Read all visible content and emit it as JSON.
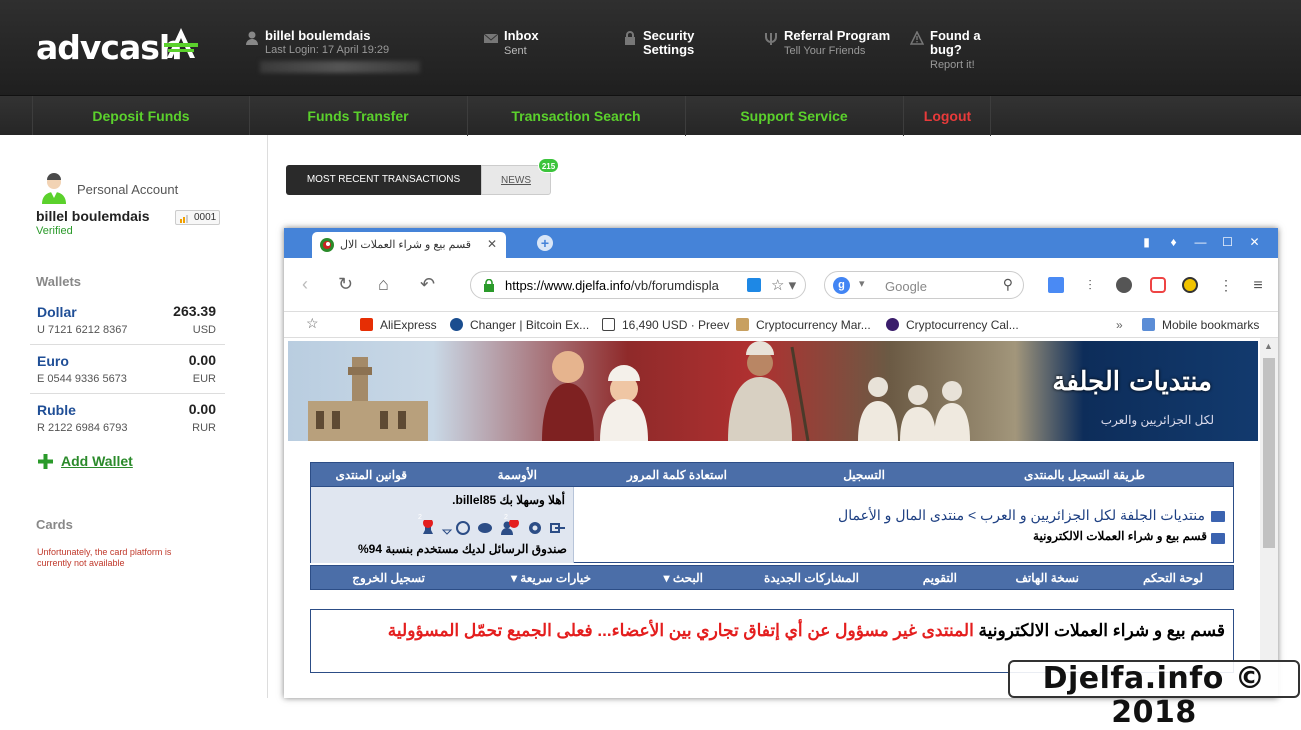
{
  "app": {
    "brand_prefix": "adv",
    "brand_suffix": "cash",
    "brand_color": "#5bd12c"
  },
  "topbar": {
    "user_name": "billel boulemdais",
    "last_login": "Last Login: 17 April 19:29",
    "inbox": {
      "label": "Inbox",
      "sub": "Sent"
    },
    "security": {
      "line1": "Security",
      "line2": "Settings"
    },
    "referral": {
      "label": "Referral Program",
      "sub": "Tell Your Friends"
    },
    "bug": {
      "line1": "Found a",
      "line2": "bug?",
      "sub": "Report it!"
    }
  },
  "nav": {
    "deposit": "Deposit Funds",
    "transfer": "Funds Transfer",
    "search": "Transaction Search",
    "support": "Support Service",
    "logout": "Logout"
  },
  "account": {
    "type": "Personal Account",
    "name": "billel boulemdais",
    "status": "Verified",
    "badge": "0001"
  },
  "wallets": {
    "title": "Wallets",
    "items": [
      {
        "name": "Dollar",
        "number": "U 7121 6212 8367",
        "amount": "263.39",
        "currency": "USD"
      },
      {
        "name": "Euro",
        "number": "E 0544 9336 5673",
        "amount": "0.00",
        "currency": "EUR"
      },
      {
        "name": "Ruble",
        "number": "R 2122 6984 6793",
        "amount": "0.00",
        "currency": "RUR"
      }
    ],
    "add_label": "Add Wallet"
  },
  "cards": {
    "title": "Cards",
    "note": "Unfortunately, the card platform is currently not available"
  },
  "tabs": {
    "recent": "MOST RECENT TRANSACTIONS",
    "news": "NEWS",
    "news_count": "215"
  },
  "browser": {
    "tab_title": "قسم بيع و شراء العملات الال",
    "url_host": "https://www.djelfa.info",
    "url_path": "/vb/forumdispla",
    "search_placeholder": "Google",
    "bookmarks": [
      "AliExpress",
      "Changer | Bitcoin Ex...",
      "16,490 USD · Preev",
      "Cryptocurrency Mar...",
      "Cryptocurrency Cal..."
    ],
    "mobile_bookmarks": "Mobile bookmarks",
    "bookmarks_more": "»"
  },
  "forum": {
    "banner_title": "منتديات الجلفة",
    "banner_sub": "لكل الجزائريين والعرب",
    "top_links": [
      "طريقة التسجيل بالمنتدى",
      "التسجيل",
      "استعادة كلمة المرور",
      "الأوسمة",
      "قوانين المنتدى"
    ],
    "welcome": "أهلا وسهلا بك billel85.",
    "inbox_usage": "صندوق الرسائل لديك مستخدم بنسبة 94%",
    "notif_count_1": "2",
    "notif_count_2": "2",
    "crumb": "منتديات الجلفة لكل الجزائريين و العرب > منتدى المال و الأعمال",
    "crumb_current": "قسم بيع و شراء العملات الالكترونية",
    "bottom_links": [
      "لوحة التحكم",
      "نسخة الهاتف",
      "التقويم",
      "المشاركات الجديدة",
      "البحث ▾",
      "خيارات سريعة ▾",
      "تسجيل الخروج"
    ],
    "notice_black": "قسم بيع و شراء العملات الالكترونية",
    "notice_red": "المنتدى غير مسؤول عن أي إتفاق تجاري بين الأعضاء... فعلى الجميع تحمّل المسؤولية"
  },
  "watermark": "Djelfa.info © 2018"
}
